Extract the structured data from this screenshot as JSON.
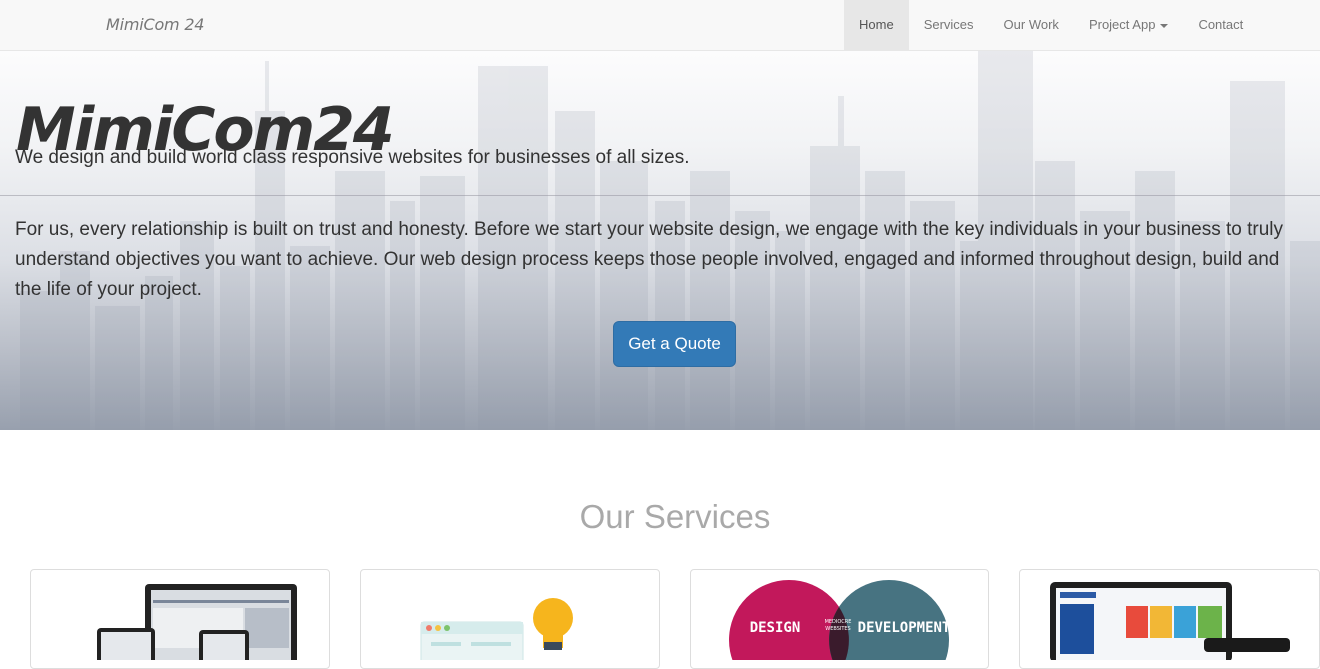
{
  "navbar": {
    "brand": "MimiCom 24",
    "items": [
      {
        "label": "Home",
        "active": true
      },
      {
        "label": "Services"
      },
      {
        "label": "Our Work"
      },
      {
        "label": "Project App",
        "dropdown": true
      },
      {
        "label": "Contact"
      }
    ]
  },
  "hero": {
    "title": "MimiCom24",
    "tagline": "We design and build world class responsive websites for businesses of all sizes.",
    "body_lines": [
      "For us, every relationship is built on trust and honesty. Before we start your website design, we engage with the key individuals in your business to truly",
      "understand objectives you want to achieve. Our web design process keeps those people involved, engaged and informed throughout design, build and",
      "the life of your project."
    ],
    "cta_label": "Get a Quote"
  },
  "services": {
    "title": "Our Services",
    "cards": [
      {
        "image": "responsive-devices-image"
      },
      {
        "image": "browser-lightbulb-image"
      },
      {
        "image": "design-development-venn-image",
        "venn_left": "DESIGN",
        "venn_middle_1": "MEDIOCRE",
        "venn_middle_2": "WEBSITES",
        "venn_right": "DEVELOPMENT"
      },
      {
        "image": "website-devices-image"
      }
    ]
  },
  "colors": {
    "primary": "#337ab7",
    "venn_left": "#c2185b",
    "venn_right": "#3d6b7a"
  }
}
